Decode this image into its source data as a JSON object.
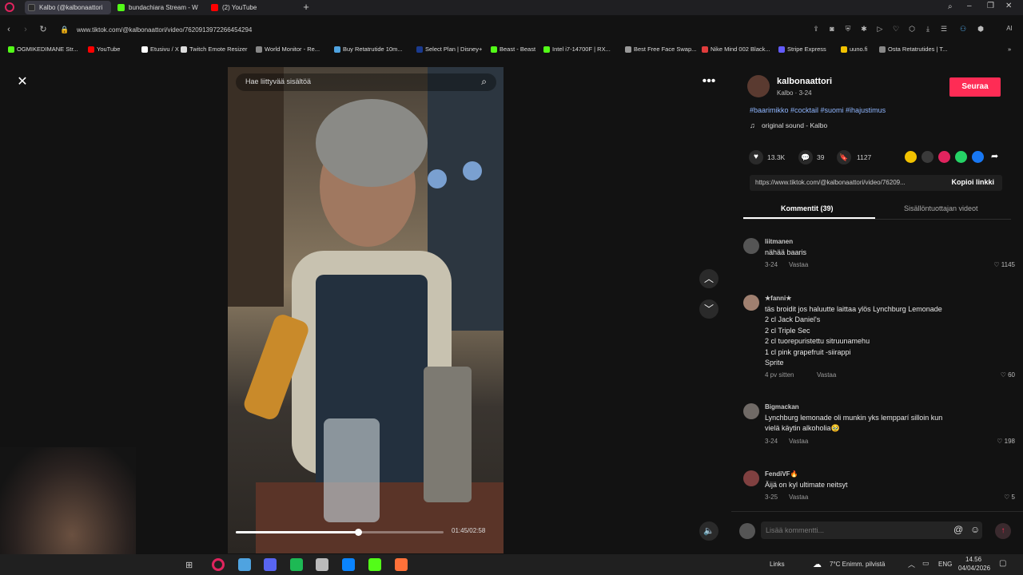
{
  "tabs": [
    {
      "label": "Kalbo (@kalbonaattori",
      "favicon_color": "#2b2b2b",
      "active": true
    },
    {
      "label": "bundachiara Stream - W",
      "favicon_color": "#53fc18",
      "active": false
    },
    {
      "label": "(2) YouTube",
      "favicon_color": "#ff0000",
      "active": false
    }
  ],
  "new_tab_icon": "plus-icon",
  "address": {
    "url": "www.tiktok.com/@kalbonaattori/video/7620913972266454294"
  },
  "bookmarks": [
    {
      "label": "OGMIKEDIMANE Str...",
      "color": "#53fc18"
    },
    {
      "label": "YouTube",
      "color": "#ff0000"
    },
    {
      "label": "Etusivu / X",
      "color": "#ffffff"
    },
    {
      "label": "Twitch Emote Resizer",
      "color": "#dddddd"
    },
    {
      "label": "World Monitor - Re...",
      "color": "#888888"
    },
    {
      "label": "Buy Retatrutide 10m...",
      "color": "#4fa3e0"
    },
    {
      "label": "Select Plan | Disney+",
      "color": "#1a3a8f"
    },
    {
      "label": "Beast - Beast",
      "color": "#53fc18"
    },
    {
      "label": "Intel i7-14700F | RX...",
      "color": "#53fc18"
    },
    {
      "label": "Best Free Face Swap...",
      "color": "#999999"
    },
    {
      "label": "Nike Mind 002 Black...",
      "color": "#e03c3c"
    },
    {
      "label": "Stripe Express",
      "color": "#635bff"
    },
    {
      "label": "uuno.fi",
      "color": "#f2c200"
    },
    {
      "label": "Osta Retatrutides | T...",
      "color": "#888888"
    }
  ],
  "video": {
    "search_placeholder": "Hae liittyvää sisältöä",
    "time": "01:45/02:58",
    "progress": 0.59
  },
  "author": {
    "name": "kalbonaattori",
    "subtitle": "Kalbo · 3-24",
    "follow_label": "Seuraa",
    "hashtags": "#baarimikko #cocktail #suomi #ihajustimus",
    "sound": "original sound - Kalbo"
  },
  "stats": {
    "likes": "13.3K",
    "comments": "39",
    "saves": "1127"
  },
  "share": {
    "link": "https://www.tiktok.com/@kalbonaattori/video/76209...",
    "copy_label": "Kopioi linkki",
    "colors": [
      "#f2c200",
      "#3a3a3a",
      "#e0245e",
      "#25d366",
      "#1877f2"
    ]
  },
  "panel_tabs": {
    "comments": "Kommentit (39)",
    "creator_videos": "Sisällöntuottajan videot"
  },
  "comments": [
    {
      "user": "liitmanen",
      "lines": [
        "nähää baaris"
      ],
      "date": "3-24",
      "reply": "Vastaa",
      "likes": "1145",
      "avatar": "#555555"
    },
    {
      "user": "★fanni★",
      "lines": [
        "täs broidit jos haluutte laittaa ylös Lynchburg Lemonade",
        "2 cl Jack Daniel's",
        "2 cl Triple Sec",
        "2 cl tuorepuristettu sitruunamehu",
        "1 cl pink grapefruit -siirappi",
        "Sprite"
      ],
      "date": "4 pv sitten",
      "reply": "Vastaa",
      "likes": "60",
      "avatar": "#a08070"
    },
    {
      "user": "Bigmackan",
      "lines": [
        "Lynchburg lemonade oli munkin yks lempparí silloin kun",
        "vielä käytin alkoholia🥹"
      ],
      "date": "3-24",
      "reply": "Vastaa",
      "likes": "198",
      "avatar": "#706a66"
    },
    {
      "user": "FendiVF🔥",
      "lines": [
        "Äijä on kyl ultimate neitsyt"
      ],
      "date": "3-25",
      "reply": "Vastaa",
      "likes": "5",
      "avatar": "#804040"
    }
  ],
  "comment_input": {
    "placeholder": "Lisää kommentti..."
  },
  "taskbar": {
    "links": "Links",
    "weather": "7°C  Enimm. pilvistä",
    "lang": "ENG",
    "time": "14.56",
    "date": "04/04/2026",
    "icon_colors": [
      "#e0245e",
      "#4fa3e0",
      "#5865f2",
      "#1db954",
      "#bbbbbb",
      "#0a84ff",
      "#53fc18",
      "#ff7139"
    ]
  }
}
